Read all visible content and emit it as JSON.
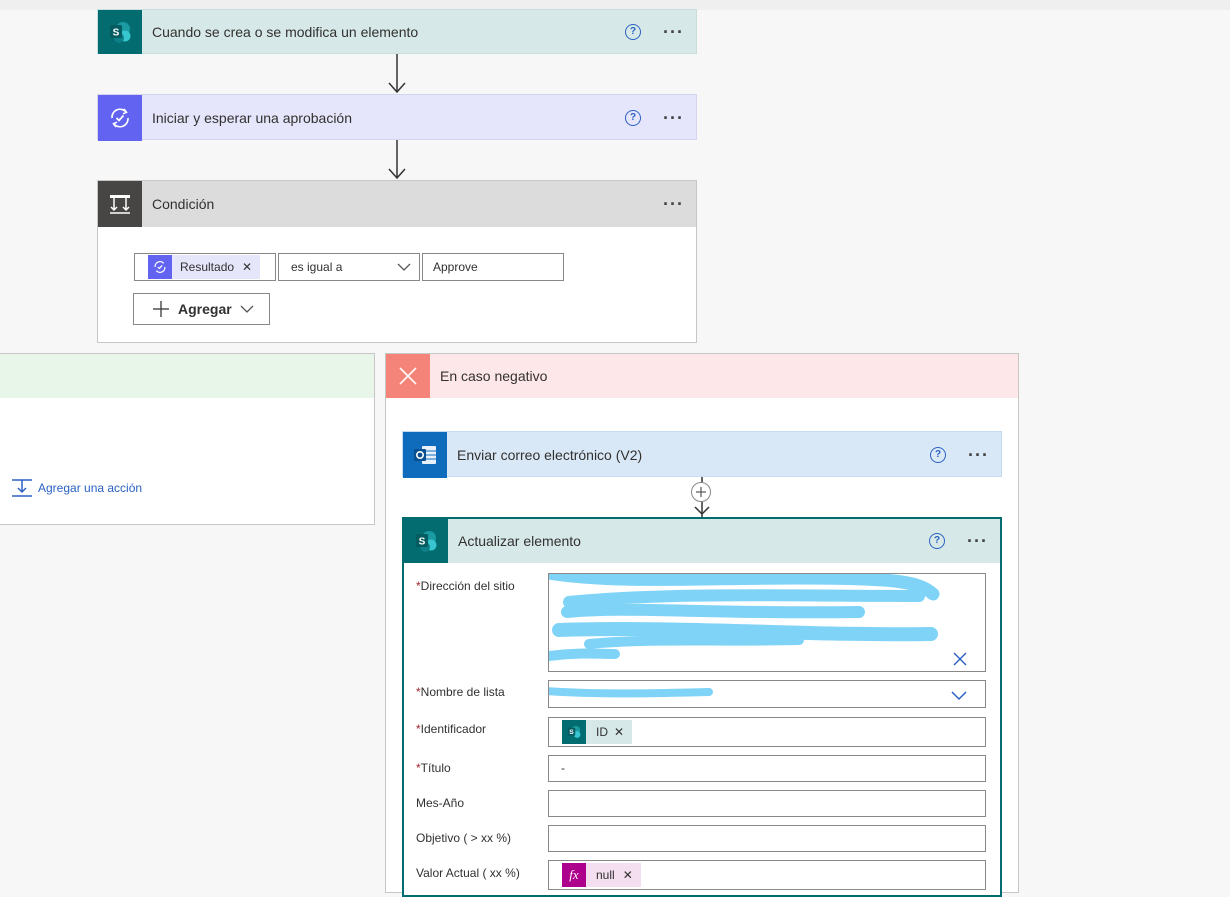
{
  "steps": {
    "trigger": {
      "title": "Cuando se crea o se modifica un elemento",
      "icon": "sharepoint-icon",
      "color": "#036c70"
    },
    "approval": {
      "title": "Iniciar y esperar una aprobación",
      "icon": "approval-icon",
      "color": "#6264f1"
    },
    "condition": {
      "title": "Condición",
      "icon": "condition-icon",
      "left_token": "Resultado",
      "operator": "es igual a",
      "value": "Approve",
      "add_label": "Agregar"
    }
  },
  "branch_yes": {
    "add_action_label": "Agregar una acción"
  },
  "branch_no": {
    "title": "En caso negativo",
    "send_email": {
      "title": "Enviar correo electrónico (V2)",
      "icon": "outlook-icon"
    },
    "update_item": {
      "title": "Actualizar elemento",
      "fields": {
        "site_address": {
          "label": "Dirección del sitio"
        },
        "list_name": {
          "label": "Nombre de lista"
        },
        "identifier": {
          "label": "Identificador",
          "token": "ID"
        },
        "title": {
          "label": "Título",
          "value": "-"
        },
        "mes_ano": {
          "label": "Mes-Año",
          "value": ""
        },
        "objetivo": {
          "label": "Objetivo ( > xx %)",
          "value": ""
        },
        "valor_actual": {
          "label": "Valor Actual ( xx %)",
          "token": "null"
        }
      }
    }
  },
  "colors": {
    "sharepoint": "#036c70",
    "approval": "#6264f1",
    "condition_dark": "#484644",
    "no_branch": "#f4847a",
    "outlook": "#0f6cbd",
    "expression": "#ad008c",
    "link": "#2b61c3"
  }
}
